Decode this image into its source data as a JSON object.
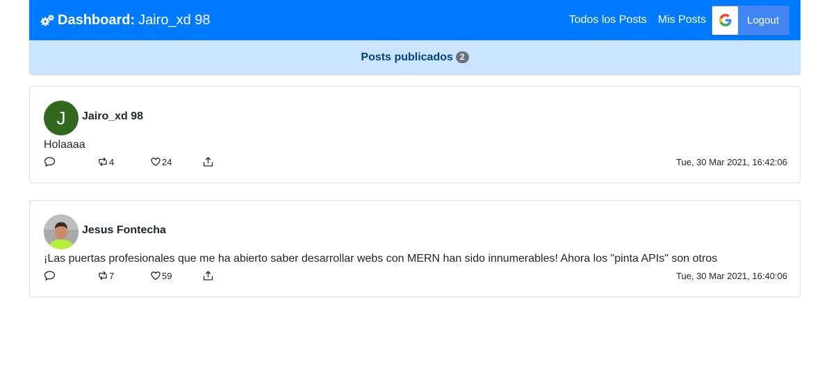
{
  "navbar": {
    "brand_label": "Dashboard:",
    "brand_user": "Jairo_xd 98",
    "links": [
      "Todos los Posts",
      "Mis Posts"
    ],
    "logout_label": "Logout",
    "colors": {
      "primary": "#007bff",
      "google": "#4285f4"
    }
  },
  "banner": {
    "title": "Posts publicados",
    "count": "2"
  },
  "posts": [
    {
      "avatar_letter": "J",
      "username": "Jairo_xd 98",
      "content": "Holaaaa",
      "retweets": "4",
      "likes": "24",
      "timestamp": "Tue, 30 Mar 2021, 16:42:06"
    },
    {
      "avatar_letter": "",
      "username": "Jesus Fontecha",
      "content": "¡Las puertas profesionales que me ha abierto saber desarrollar webs con MERN han sido innumerables! Ahora los \"pinta APIs\" son otros",
      "retweets": "7",
      "likes": "59",
      "timestamp": "Tue, 30 Mar 2021, 16:40:06"
    }
  ]
}
